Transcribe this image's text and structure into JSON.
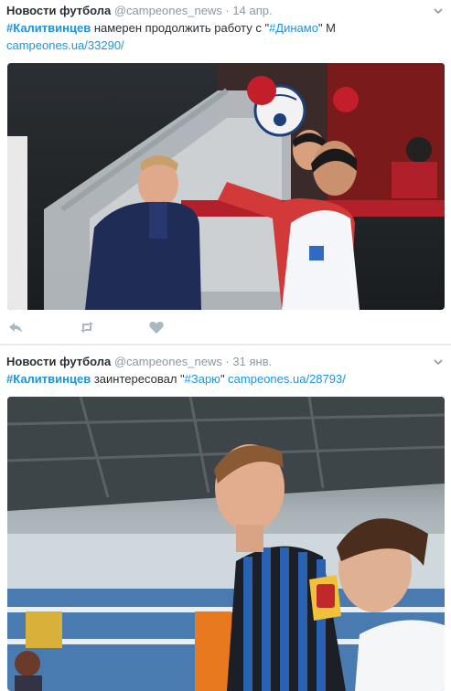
{
  "tweets": [
    {
      "author": "Новости футбола",
      "handle": "@campeones_news",
      "dot": "·",
      "date": "14 апр.",
      "text_parts": {
        "hashtag1": "#Калитвинцев",
        "mid": " намерен продолжить работу с \"",
        "hashtag2": "#Динамо",
        "end": "\" М",
        "link": "campeones.ua/33290/"
      },
      "photo_alt": "Калитвинцев у бровки, игрок Спартака вбрасывает мяч",
      "actions": {
        "reply": "reply-icon",
        "retweet": "retweet-icon",
        "like": "heart-icon"
      }
    },
    {
      "author": "Новости футбола",
      "handle": "@campeones_news",
      "dot": "·",
      "date": "31 янв.",
      "text_parts": {
        "hashtag1": "#Калитвинцев",
        "mid": " заинтересовал \"",
        "hashtag2": "#Зарю",
        "end": "\" ",
        "link": "campeones.ua/28793/"
      },
      "photo_alt": "Игрок Черноморца на стадионе с юным болельщиком"
    }
  ],
  "colors": {
    "link": "#1b95e0",
    "meta": "#8899a6",
    "text": "#292f33",
    "icon": "#aab8c2"
  }
}
